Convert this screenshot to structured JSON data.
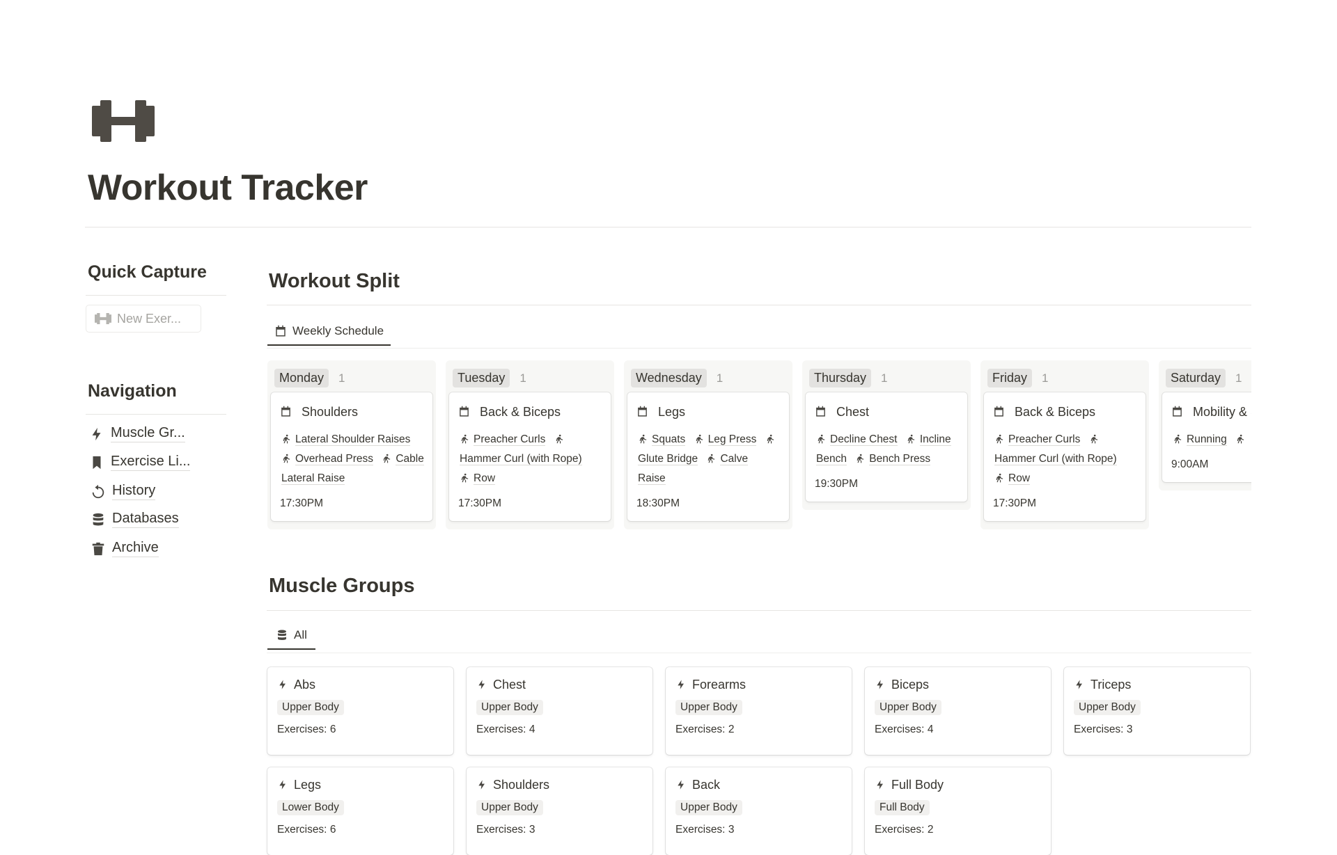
{
  "page": {
    "title": "Workout Tracker",
    "icon": "dumbbell-icon"
  },
  "sidebar": {
    "quick_capture": {
      "heading": "Quick Capture",
      "button_label": "New Exer..."
    },
    "navigation": {
      "heading": "Navigation",
      "items": [
        {
          "label": "Muscle Gr...",
          "icon": "bolt-icon"
        },
        {
          "label": "Exercise Li...",
          "icon": "bookmark-icon"
        },
        {
          "label": "History",
          "icon": "history-icon"
        },
        {
          "label": "Databases",
          "icon": "database-icon"
        },
        {
          "label": "Archive",
          "icon": "trash-icon"
        }
      ]
    }
  },
  "workout_split": {
    "heading": "Workout Split",
    "tab": "Weekly Schedule",
    "columns": [
      {
        "day": "Monday",
        "count": "1",
        "card": {
          "title": "Shoulders",
          "exercises": [
            "Lateral Shoulder Raises",
            "Overhead Press",
            "Cable Lateral Raise"
          ],
          "time": "17:30PM"
        }
      },
      {
        "day": "Tuesday",
        "count": "1",
        "card": {
          "title": "Back & Biceps",
          "exercises": [
            "Preacher Curls",
            "Hammer Curl (with Rope)",
            "Row"
          ],
          "time": "17:30PM"
        }
      },
      {
        "day": "Wednesday",
        "count": "1",
        "card": {
          "title": "Legs",
          "exercises": [
            "Squats",
            "Leg Press",
            "Glute Bridge",
            "Calve Raise"
          ],
          "time": "18:30PM"
        }
      },
      {
        "day": "Thursday",
        "count": "1",
        "card": {
          "title": "Chest",
          "exercises": [
            "Decline Chest",
            "Incline Bench",
            "Bench Press"
          ],
          "time": "19:30PM"
        }
      },
      {
        "day": "Friday",
        "count": "1",
        "card": {
          "title": "Back & Biceps",
          "exercises": [
            "Preacher Curls",
            "Hammer Curl (with Rope)",
            "Row"
          ],
          "time": "17:30PM"
        }
      },
      {
        "day": "Saturday",
        "count": "1",
        "card": {
          "title": "Mobility & Stretching",
          "exercises": [
            "Running",
            ""
          ],
          "time": "9:00AM"
        }
      }
    ]
  },
  "muscle_groups": {
    "heading": "Muscle Groups",
    "tab": "All",
    "count_label": "Exercises:",
    "cards": [
      {
        "name": "Abs",
        "tag": "Upper Body",
        "exercises": "6"
      },
      {
        "name": "Chest",
        "tag": "Upper Body",
        "exercises": "4"
      },
      {
        "name": "Forearms",
        "tag": "Upper Body",
        "exercises": "2"
      },
      {
        "name": "Biceps",
        "tag": "Upper Body",
        "exercises": "4"
      },
      {
        "name": "Triceps",
        "tag": "Upper Body",
        "exercises": "3"
      },
      {
        "name": "Legs",
        "tag": "Lower Body",
        "exercises": "6"
      },
      {
        "name": "Shoulders",
        "tag": "Upper Body",
        "exercises": "3"
      },
      {
        "name": "Back",
        "tag": "Upper Body",
        "exercises": "3"
      },
      {
        "name": "Full Body",
        "tag": "Full Body",
        "exercises": "2"
      }
    ]
  },
  "colors": {
    "text": "#37352f",
    "board_bg": "#f7f7f5",
    "tag_bg": "#e3e2e0"
  }
}
